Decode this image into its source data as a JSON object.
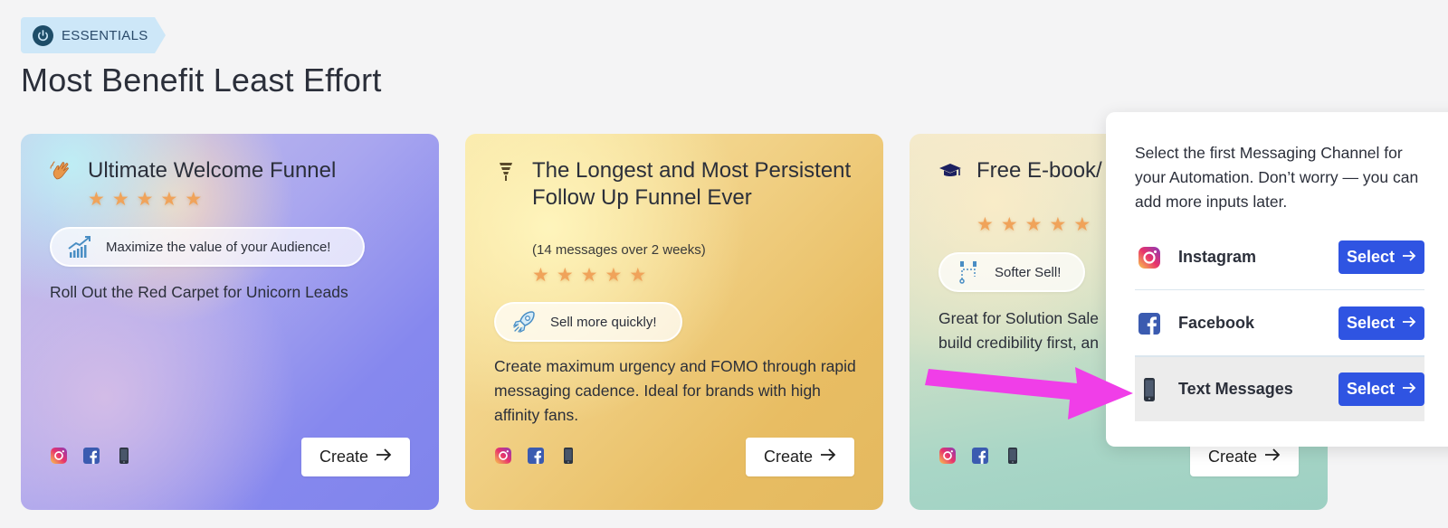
{
  "badge": {
    "label": "ESSENTIALS",
    "icon": "power-icon"
  },
  "page_title": "Most Benefit Least Effort",
  "cards": [
    {
      "icon": "waving-hand-icon",
      "title": "Ultimate Welcome Funnel",
      "subtitle": "",
      "rating": 5,
      "pill": {
        "icon": "growth-chart-icon",
        "label": "Maximize the value of your Audience!"
      },
      "description": "Roll Out the Red Carpet for Unicorn Leads",
      "channels": [
        "instagram-icon",
        "facebook-icon",
        "phone-icon"
      ],
      "create_label": "Create"
    },
    {
      "icon": "funnel-icon",
      "title": "The Longest and Most Persistent Follow Up Funnel Ever",
      "subtitle": "(14 messages over 2 weeks)",
      "rating": 5,
      "pill": {
        "icon": "rocket-icon",
        "label": "Sell more quickly!"
      },
      "description": "Create maximum urgency and FOMO through rapid messaging cadence. Ideal for brands with high affinity fans.",
      "channels": [
        "instagram-icon",
        "facebook-icon",
        "phone-icon"
      ],
      "create_label": "Create"
    },
    {
      "icon": "graduation-cap-icon",
      "title": "Free E-book/ Download Of",
      "subtitle": "",
      "rating": 5,
      "pill": {
        "icon": "path-icon",
        "label": "Softer Sell!"
      },
      "description": "Great for Solution Sale build credibility first, an",
      "channels": [
        "instagram-icon",
        "facebook-icon",
        "phone-icon"
      ],
      "create_label": "Create"
    }
  ],
  "popup": {
    "text": "Select the first Messaging Channel for your Automation. Don’t worry — you can add more inputs later.",
    "options": [
      {
        "icon": "instagram-icon",
        "label": "Instagram",
        "button": "Select",
        "highlighted": false
      },
      {
        "icon": "facebook-icon",
        "label": "Facebook",
        "button": "Select",
        "highlighted": false
      },
      {
        "icon": "phone-icon",
        "label": "Text Messages",
        "button": "Select",
        "highlighted": true
      }
    ]
  },
  "colors": {
    "accent": "#2f54e2",
    "star": "#f0a35a",
    "arrow": "#f03ee8",
    "badge_bg": "#cde7f8"
  }
}
